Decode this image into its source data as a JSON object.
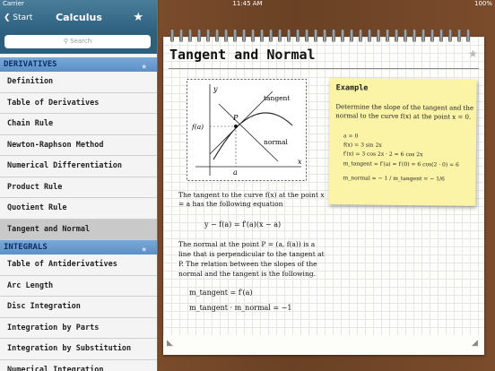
{
  "status": {
    "carrier": "Carrier",
    "time": "11:45 AM",
    "battery": "100%"
  },
  "sidebar": {
    "back_label": "Start",
    "title": "Calculus",
    "search_placeholder": "Search",
    "sections": [
      {
        "title": "DERIVATIVES",
        "items": [
          "Definition",
          "Table of Derivatives",
          "Chain Rule",
          "Newton-Raphson Method",
          "Numerical Differentiation",
          "Product Rule",
          "Quotient Rule",
          "Tangent and Normal"
        ]
      },
      {
        "title": "INTEGRALS",
        "items": [
          "Table of Antiderivatives",
          "Arc Length",
          "Disc Integration",
          "Integration by Parts",
          "Integration by Substitution",
          "Numerical Integration"
        ]
      }
    ],
    "selected_item": "Tangent and Normal"
  },
  "page": {
    "title": "Tangent and Normal",
    "figure": {
      "y_label": "y",
      "x_label": "x",
      "f_label": "f(a)",
      "a_label": "a",
      "p_label": "P",
      "tangent_label": "tangent",
      "normal_label": "normal"
    },
    "para1_line1": "The tangent to the curve f(x) at the point x",
    "para1_line2": "= a has the following equation",
    "formula1": "y − f(a) = f′(a)(x − a)",
    "para2_line1": "The normal at the point P = (a, f(a)) is a",
    "para2_line2": "line that is perpendicular to the tangent at",
    "para2_line3": "P. The relation between the slopes of the",
    "para2_line4": "normal and the tangent is the following.",
    "formula2": "m_tangent = f′(a)",
    "formula3": "m_tangent · m_normal = −1",
    "example": {
      "title": "Example",
      "line1": "Determine the slope of the tangent and the",
      "line2": "normal to the curve f(x) at the point x = 0.",
      "f1": "a = 0",
      "f2": "f(x) = 3 sin 2x",
      "f3": "f′(x) = 3 cos 2x · 2 = 6 cos 2x",
      "f4": "m_tangent = f′(a) = f′(0) = 6 cos(2 · 0) = 6",
      "f5": "m_normal = − 1 / m_tangent = − 1/6"
    }
  }
}
